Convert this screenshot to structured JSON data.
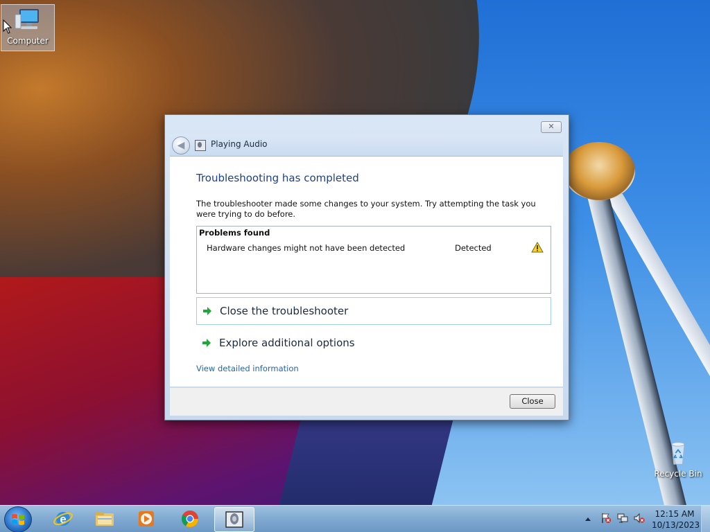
{
  "desktop": {
    "icons": [
      {
        "name": "computer",
        "label": "Computer"
      },
      {
        "name": "recycle-bin",
        "label": "Recycle Bin"
      }
    ]
  },
  "dialog": {
    "nav_title": "Playing Audio",
    "heading": "Troubleshooting has completed",
    "description": "The troubleshooter made some changes to your system. Try attempting the task you were trying to do before.",
    "problems_title": "Problems found",
    "problem": {
      "text": "Hardware changes might not have been detected",
      "status": "Detected"
    },
    "options": [
      {
        "label": "Close the troubleshooter"
      },
      {
        "label": "Explore additional options"
      }
    ],
    "detail_link": "View detailed information",
    "close_button": "Close",
    "close_glyph": "✕"
  },
  "taskbar": {
    "apps": [
      "internet-explorer",
      "windows-explorer",
      "windows-media-player",
      "google-chrome",
      "playing-audio-troubleshooter"
    ],
    "clock": {
      "time": "12:15 AM",
      "date": "10/13/2023"
    }
  },
  "colors": {
    "heading": "#1e3f8a",
    "link": "#2664a8",
    "accent_arrow": "#1fa83a"
  }
}
